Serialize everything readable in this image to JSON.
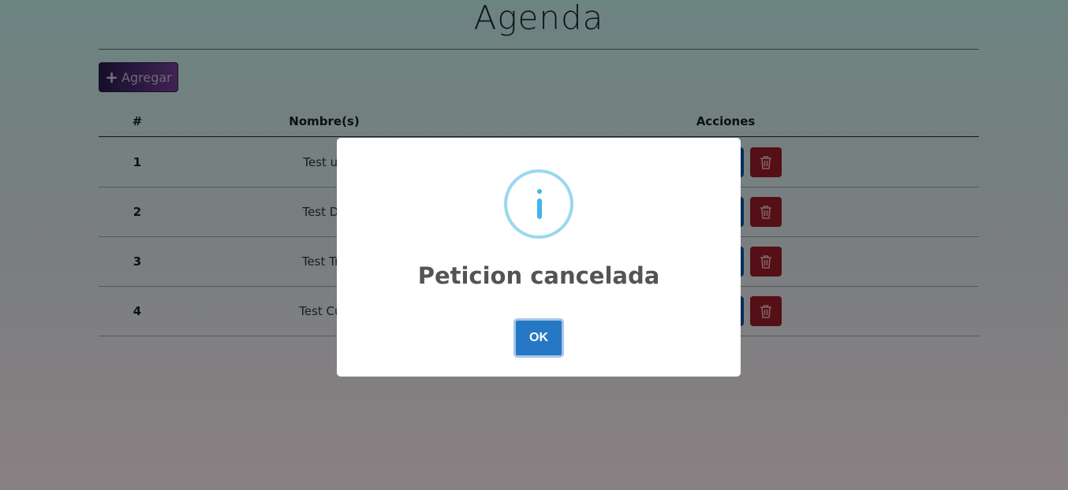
{
  "page": {
    "title": "Agenda",
    "add_button_label": "Agregar",
    "add_icon": "plus-icon"
  },
  "table": {
    "headers": {
      "number": "#",
      "name": "Nombre(s)",
      "actions": "Acciones"
    },
    "rows": [
      {
        "number": "1",
        "name": "Test un"
      },
      {
        "number": "2",
        "name": "Test Do"
      },
      {
        "number": "3",
        "name": "Test Tre"
      },
      {
        "number": "4",
        "name": "Test Cua"
      }
    ],
    "edit_icon": "edit-icon",
    "delete_icon": "trash-icon"
  },
  "modal": {
    "icon": "info-icon",
    "title": "Peticion cancelada",
    "ok_label": "OK"
  },
  "colors": {
    "add_button": "#241846",
    "edit_button": "#0e4ea0",
    "delete_button": "#8c1c26",
    "ok_button": "#2778c4",
    "info_icon": "#3fb7e6"
  }
}
